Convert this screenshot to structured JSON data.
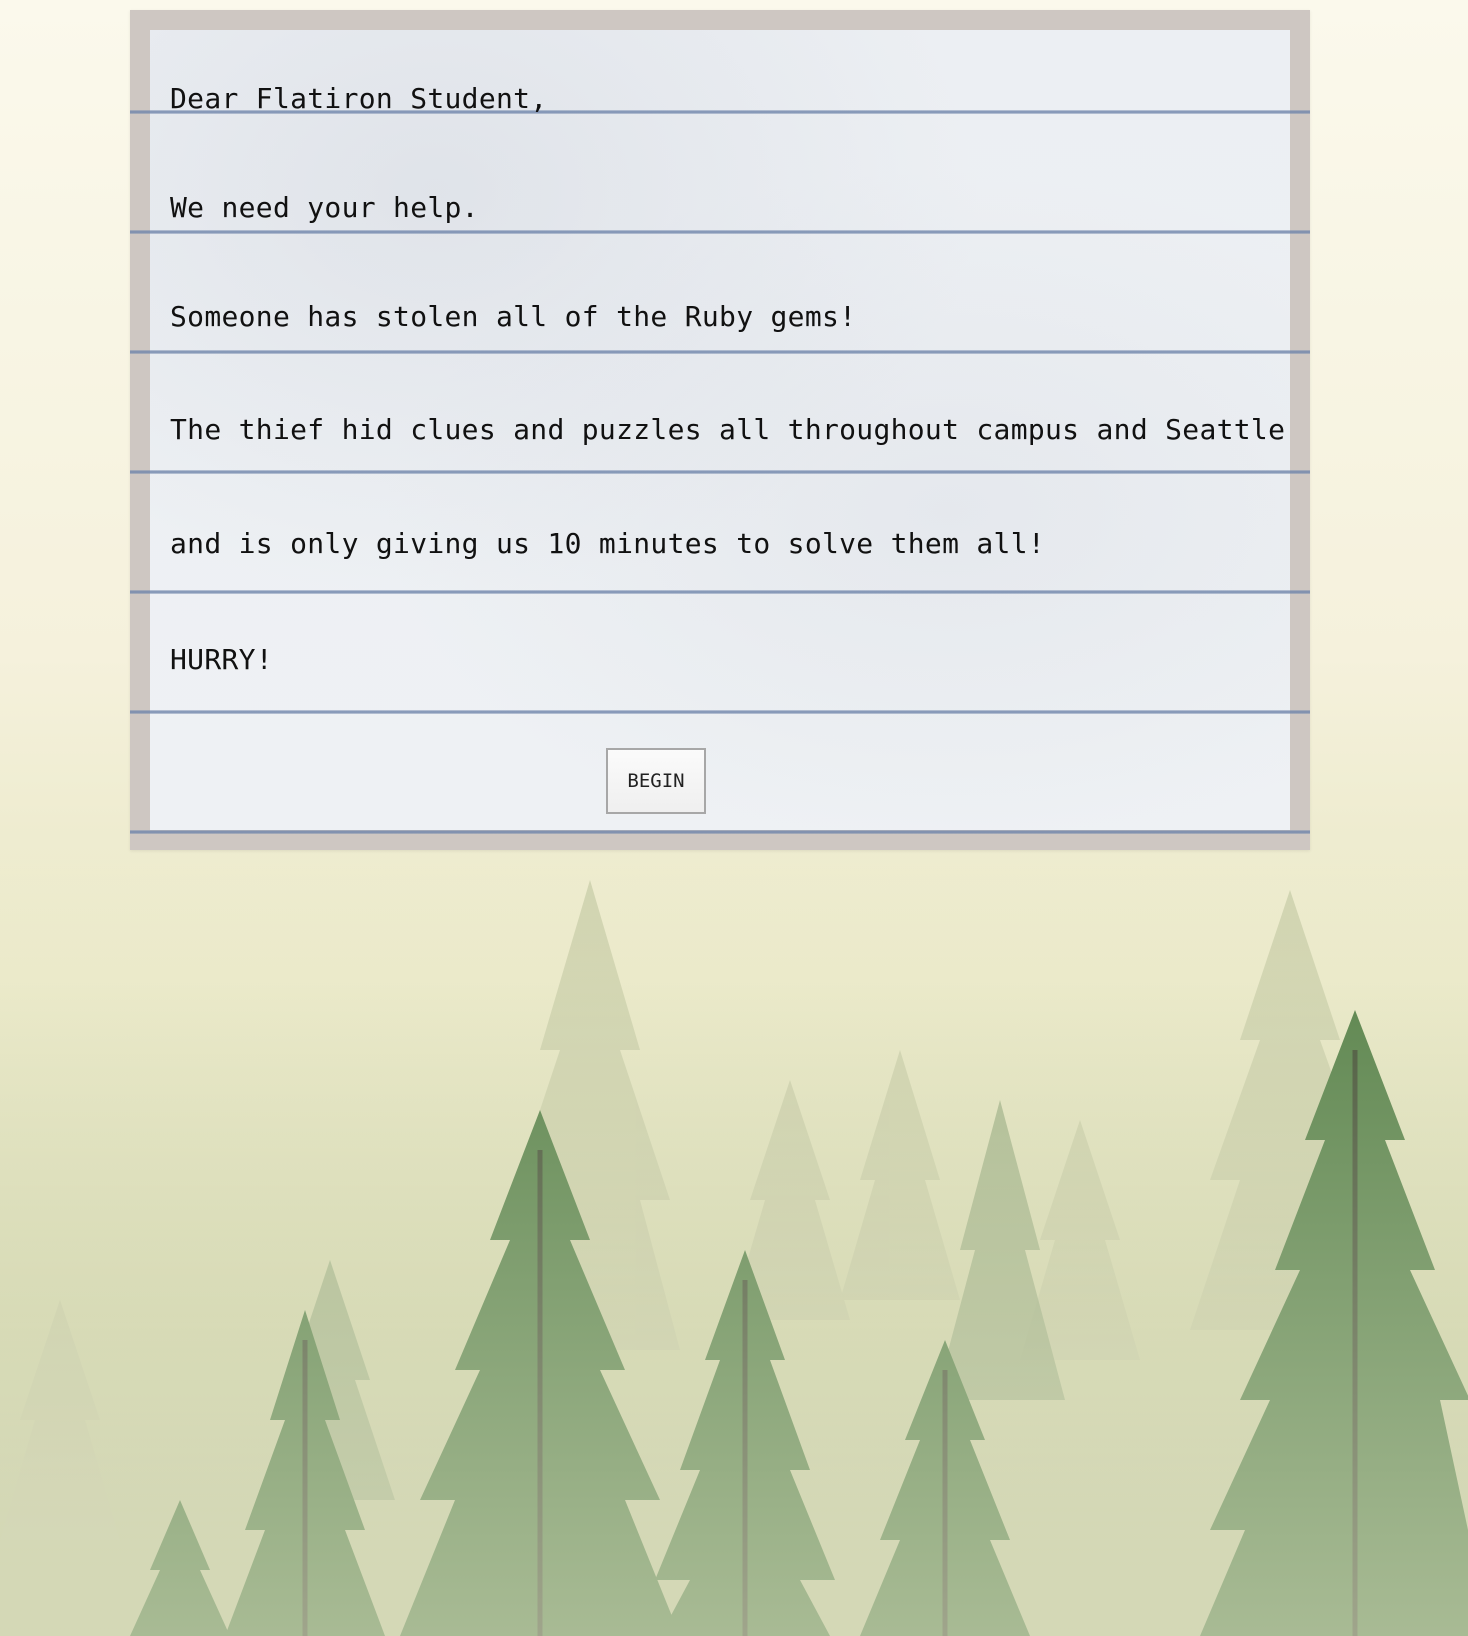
{
  "letter": {
    "lines": [
      "Dear Flatiron Student,",
      "We need your help.",
      "Someone has stolen all of the Ruby gems!",
      "The thief hid clues and puzzles all throughout campus and Seattle",
      "and is only giving us 10 minutes to solve them all!",
      "HURRY!"
    ],
    "begin_label": "BEGIN"
  },
  "colors": {
    "paper": "#eef1f4",
    "paper_border": "#cec7c2",
    "rule": "#8a9cc0",
    "background_light": "#fbf9ec",
    "forest_green": "#3f6b35"
  }
}
